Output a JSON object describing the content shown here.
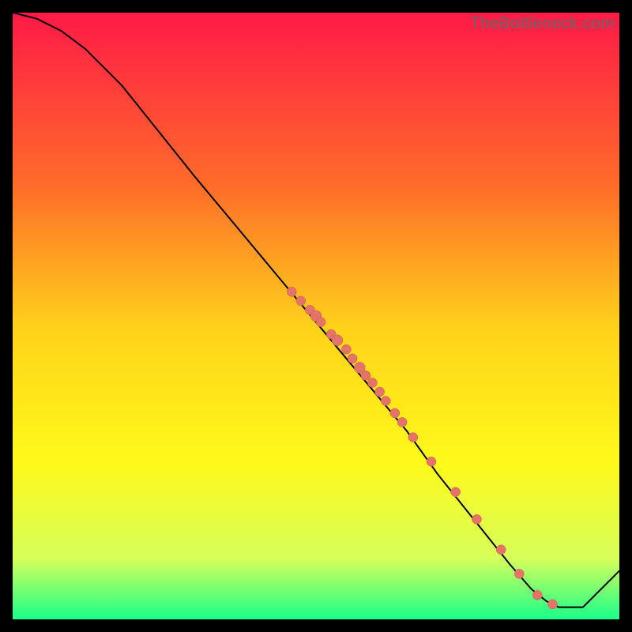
{
  "watermark": "TheBottleneck.com",
  "colors": {
    "gradient_top": "#ff1a47",
    "gradient_mid_upper": "#ff6a2a",
    "gradient_mid": "#ffd21a",
    "gradient_mid_lower": "#fff91a",
    "gradient_lower": "#d6ff5a",
    "gradient_bottom": "#1aff8a",
    "line": "#000000",
    "dot_fill": "#e57368",
    "dot_stroke": "#c95b52"
  },
  "chart_data": {
    "type": "line",
    "title": "",
    "xlabel": "",
    "ylabel": "",
    "xlim": [
      0,
      100
    ],
    "ylim": [
      0,
      100
    ],
    "series": [
      {
        "name": "curve",
        "x": [
          0,
          4,
          8,
          12,
          15,
          18,
          22,
          26,
          30,
          35,
          40,
          45,
          50,
          55,
          60,
          65,
          70,
          74,
          78,
          82,
          85.5,
          88,
          90,
          94,
          100
        ],
        "y": [
          100,
          99,
          97,
          94,
          91,
          88,
          83,
          78,
          73,
          67,
          61,
          55,
          49,
          43,
          37,
          31,
          24,
          19,
          14,
          9,
          5,
          3,
          2,
          2,
          8
        ]
      }
    ],
    "scatter": {
      "name": "points",
      "x": [
        46,
        47.5,
        49,
        50,
        50.8,
        52.5,
        53.5,
        55,
        56,
        57.2,
        58.2,
        59.3,
        60.5,
        61.5,
        63,
        64.2,
        66,
        69,
        73,
        76.5,
        80.5,
        83.5,
        86.5,
        89
      ],
      "y": [
        54,
        52.5,
        51,
        50,
        49,
        47,
        46,
        44.5,
        43,
        41.5,
        40.2,
        39,
        37.5,
        36,
        34,
        32.5,
        30,
        26,
        21,
        16.5,
        11.5,
        7.5,
        4,
        2.5
      ],
      "r": [
        6,
        6,
        6,
        7,
        6,
        6,
        7,
        6,
        6,
        7,
        6,
        6,
        6,
        6,
        6,
        6,
        6,
        6,
        6,
        6,
        6,
        6,
        6,
        6
      ]
    }
  }
}
